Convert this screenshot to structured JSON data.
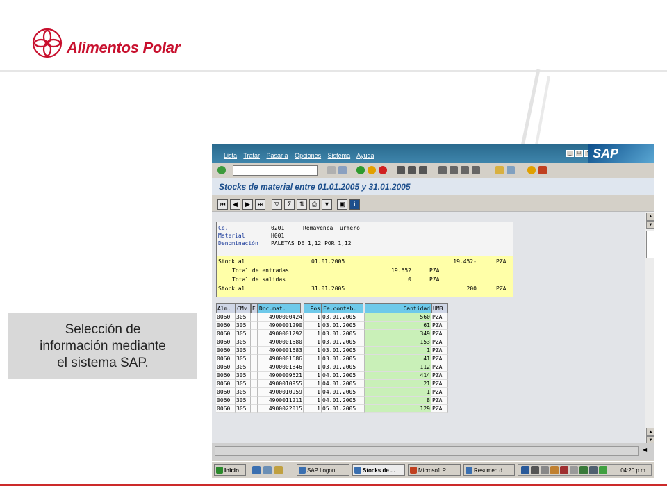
{
  "brand": {
    "name": "Alimentos Polar",
    "color": "#c8102e"
  },
  "caption": "Selección de\ninformación mediante\nel sistema SAP.",
  "sap": {
    "menu": [
      "Lista",
      "Tratar",
      "Pasar a",
      "Opciones",
      "Sistema",
      "Ayuda"
    ],
    "logo": "SAP",
    "title": "Stocks de material entre 01.01.2005 y 31.01.2005",
    "header": {
      "centro_label": "Ce.",
      "centro_code": "0201",
      "centro_name": "Remavenca Turmero",
      "material_label": "Material",
      "material_value": "H001",
      "denominacion_label": "Denominación",
      "denominacion_value": "PALETAS DE 1,12 POR 1,12"
    },
    "stock": {
      "r1_label": "Stock al",
      "r1_date": "01.01.2005",
      "r1_value": "19.452-",
      "r1_unit": "PZA",
      "r2_label": "Total de entradas",
      "r2_value": "19.652",
      "r2_unit": "PZA",
      "r3_label": "Total de salidas",
      "r3_value": "0",
      "r3_unit": "PZA",
      "r4_label": "Stock al",
      "r4_date": "31.01.2005",
      "r4_value": "200",
      "r4_unit": "PZA"
    },
    "columns": [
      "Alm.",
      "CMv",
      "E",
      "Doc.mat.",
      "Pos",
      "Fe.contab.",
      "Cantidad",
      "UMB"
    ],
    "rows": [
      [
        "0060",
        "305",
        "",
        "4900000424",
        "1",
        "03.01.2005",
        "560",
        "PZA"
      ],
      [
        "0060",
        "305",
        "",
        "4900001290",
        "1",
        "03.01.2005",
        "61",
        "PZA"
      ],
      [
        "0060",
        "305",
        "",
        "4900001292",
        "1",
        "03.01.2005",
        "349",
        "PZA"
      ],
      [
        "0060",
        "305",
        "",
        "4900001680",
        "1",
        "03.01.2005",
        "153",
        "PZA"
      ],
      [
        "0060",
        "305",
        "",
        "4900001683",
        "1",
        "03.01.2005",
        "1",
        "PZA"
      ],
      [
        "0060",
        "305",
        "",
        "4900001686",
        "1",
        "03.01.2005",
        "41",
        "PZA"
      ],
      [
        "0060",
        "305",
        "",
        "4900001846",
        "1",
        "03.01.2005",
        "112",
        "PZA"
      ],
      [
        "0060",
        "305",
        "",
        "4900009621",
        "1",
        "04.01.2005",
        "414",
        "PZA"
      ],
      [
        "0060",
        "305",
        "",
        "4900010955",
        "1",
        "04.01.2005",
        "21",
        "PZA"
      ],
      [
        "0060",
        "305",
        "",
        "4900010959",
        "1",
        "04.01.2005",
        "1",
        "PZA"
      ],
      [
        "0060",
        "305",
        "",
        "4900011211",
        "1",
        "04.01.2005",
        "8",
        "PZA"
      ],
      [
        "0060",
        "305",
        "",
        "4900022015",
        "1",
        "05.01.2005",
        "129",
        "PZA"
      ]
    ]
  },
  "taskbar": {
    "start": "Inicio",
    "tasks": [
      "SAP Logon ...",
      "Stocks de ...",
      "Microsoft P...",
      "Resumen d..."
    ],
    "clock": "04:20 p.m."
  }
}
